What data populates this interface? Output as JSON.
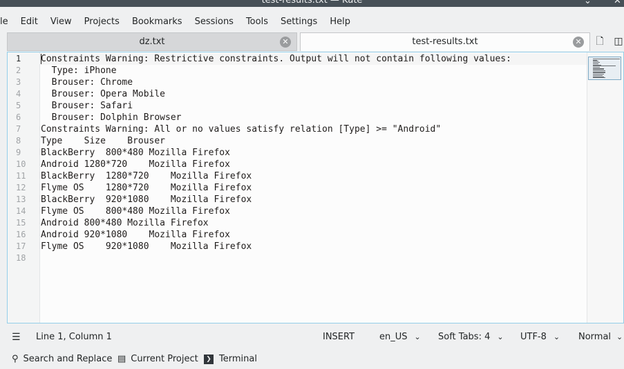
{
  "window": {
    "title": "test-results.txt — Kate",
    "minimize_icon": "chevron-down-icon",
    "close_icon": "close-icon"
  },
  "menubar": {
    "items": [
      "le",
      "Edit",
      "View",
      "Projects",
      "Bookmarks",
      "Sessions",
      "Tools",
      "Settings",
      "Help"
    ]
  },
  "tabs": [
    {
      "label": "dz.txt",
      "active": false
    },
    {
      "label": "test-results.txt",
      "active": true
    }
  ],
  "editor": {
    "lines": [
      "Constraints Warning: Restrictive constraints. Output will not contain following values:",
      "  Type: iPhone",
      "  Brouser: Chrome",
      "  Brouser: Opera Mobile",
      "  Brouser: Safari",
      "  Brouser: Dolphin Browser",
      "Constraints Warning: All or no values satisfy relation [Type] >= \"Android\"",
      "Type    Size    Brouser",
      "BlackBerry  800*480 Mozilla Firefox",
      "Android 1280*720    Mozilla Firefox",
      "BlackBerry  1280*720    Mozilla Firefox",
      "Flyme OS    1280*720    Mozilla Firefox",
      "BlackBerry  920*1080    Mozilla Firefox",
      "Flyme OS    800*480 Mozilla Firefox",
      "Android 800*480 Mozilla Firefox",
      "Android 920*1080    Mozilla Firefox",
      "Flyme OS    920*1080    Mozilla Firefox",
      ""
    ],
    "line_numbers": [
      "1",
      "2",
      "3",
      "4",
      "5",
      "6",
      "7",
      "8",
      "9",
      "10",
      "11",
      "12",
      "13",
      "14",
      "15",
      "16",
      "17",
      "18"
    ]
  },
  "statusbar": {
    "position": "Line 1, Column 1",
    "mode": "INSERT",
    "dictionary": "en_US",
    "indent": "Soft Tabs: 4",
    "encoding": "UTF-8",
    "highlight": "Normal"
  },
  "bottombar": {
    "search": "Search and Replace",
    "project": "Current Project",
    "terminal": "Terminal"
  }
}
